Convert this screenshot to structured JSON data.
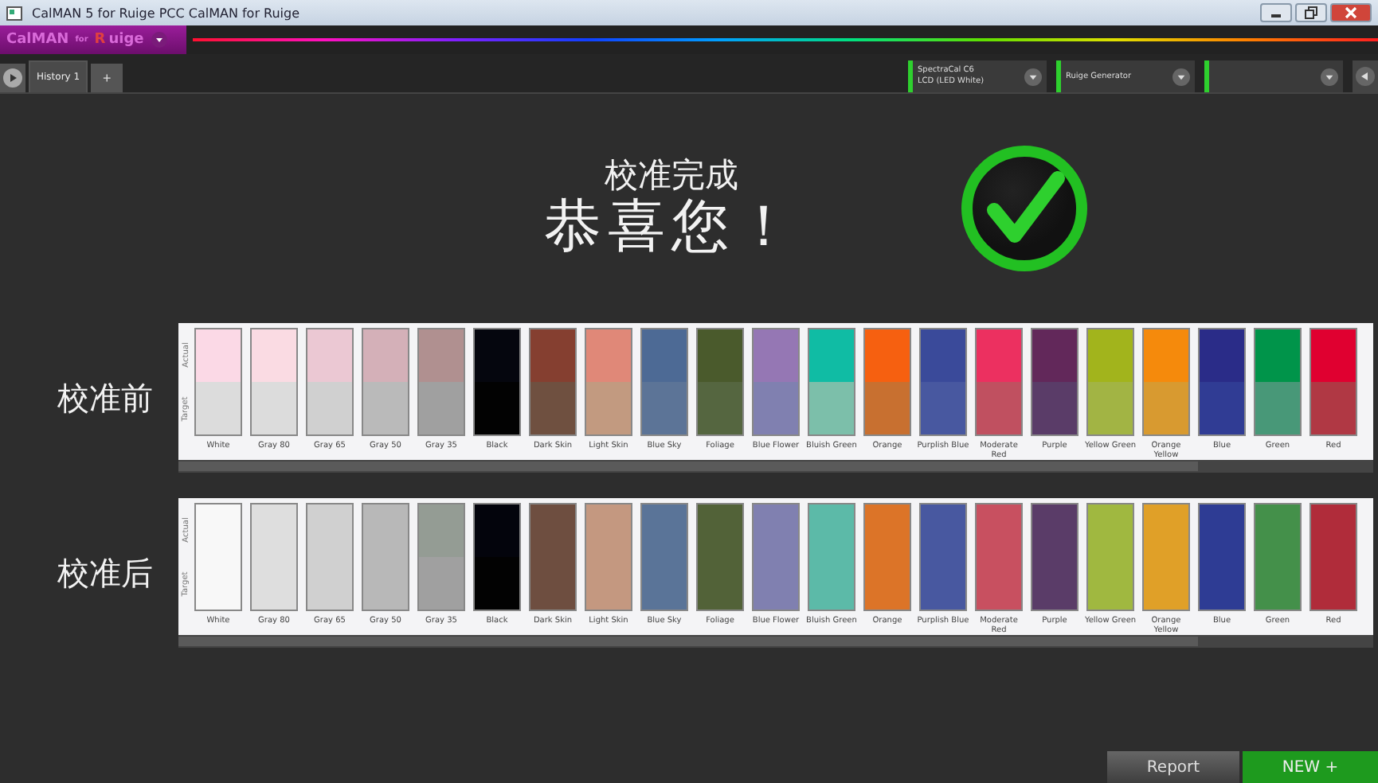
{
  "window": {
    "title": "CalMAN 5 for Ruige PCC CalMAN for Ruige"
  },
  "logo": {
    "name": "CalMAN",
    "connector": "for",
    "brand_initial": "R",
    "brand_rest": "uige"
  },
  "tabs": [
    {
      "label": "History 1",
      "selected": true
    }
  ],
  "add_tab": "+",
  "dropdowns": [
    {
      "kind": "labeled",
      "lines": [
        "SpectraCal C6",
        "LCD (LED White)"
      ]
    },
    {
      "kind": "labeled",
      "lines": [
        "Ruige Generator"
      ]
    },
    {
      "kind": "blank"
    }
  ],
  "heading": {
    "subtitle": "校准完成",
    "title": "恭喜您！"
  },
  "comparisons": [
    {
      "label": "校准前",
      "axis_actual": "Actual",
      "axis_target": "Target",
      "patches": [
        {
          "name": "White",
          "actual": {
            "color": "#fbd9e6"
          },
          "target": {
            "color": "#dcdcdc"
          }
        },
        {
          "name": "Gray 80",
          "actual": {
            "color": "#fadbe3"
          },
          "target": {
            "color": "#dcdcdc"
          }
        },
        {
          "name": "Gray 65",
          "actual": {
            "color": "#ebc8d3"
          },
          "target": {
            "color": "#d0d0d0"
          }
        },
        {
          "name": "Gray 50",
          "actual": {
            "color": "#d4b0b8"
          },
          "target": {
            "color": "#bababa"
          }
        },
        {
          "name": "Gray 35",
          "actual": {
            "color": "#b09090"
          },
          "target": {
            "color": "#a0a0a0"
          }
        },
        {
          "name": "Black",
          "actual": {
            "color": "#05060e"
          },
          "target": {
            "color": "#020202"
          }
        },
        {
          "name": "Dark Skin",
          "actual": {
            "color": "#853f30"
          },
          "target": {
            "color": "#6f5040"
          }
        },
        {
          "name": "Light Skin",
          "actual": {
            "color": "#e08878"
          },
          "target": {
            "color": "#c29a80"
          }
        },
        {
          "name": "Blue Sky",
          "actual": {
            "color": "#4d6a95"
          },
          "target": {
            "color": "#5c7497"
          }
        },
        {
          "name": "Foliage",
          "actual": {
            "color": "#4a5a2c"
          },
          "target": {
            "color": "#556640"
          }
        },
        {
          "name": "Blue Flower",
          "actual": {
            "color": "#9577b4"
          },
          "target": {
            "color": "#8080b0"
          }
        },
        {
          "name": "Bluish Green",
          "actual": {
            "color": "#10bca4"
          },
          "target": {
            "color": "#7cbfaa"
          }
        },
        {
          "name": "Orange",
          "actual": {
            "color": "#f66010"
          },
          "target": {
            "color": "#c87030"
          }
        },
        {
          "name": "Purplish Blue",
          "actual": {
            "color": "#3a4a9a"
          },
          "target": {
            "color": "#4858a0"
          }
        },
        {
          "name": "Moderate Red",
          "actual": {
            "color": "#ec3060"
          },
          "target": {
            "color": "#c05060"
          }
        },
        {
          "name": "Purple",
          "actual": {
            "color": "#62285a"
          },
          "target": {
            "color": "#5a3c68"
          }
        },
        {
          "name": "Yellow Green",
          "actual": {
            "color": "#a2b41c"
          },
          "target": {
            "color": "#a2b444"
          }
        },
        {
          "name": "Orange Yellow",
          "actual": {
            "color": "#f58a0c"
          },
          "target": {
            "color": "#d89a30"
          }
        },
        {
          "name": "Blue",
          "actual": {
            "color": "#2a2c88"
          },
          "target": {
            "color": "#303c94"
          }
        },
        {
          "name": "Green",
          "actual": {
            "color": "#00944a"
          },
          "target": {
            "color": "#489878"
          }
        },
        {
          "name": "Red",
          "actual": {
            "color": "#e00030"
          },
          "target": {
            "color": "#b03844"
          }
        }
      ]
    },
    {
      "label": "校准后",
      "axis_actual": "Actual",
      "axis_target": "Target",
      "patches": [
        {
          "name": "White",
          "actual": {
            "color": "#f8f8f8"
          },
          "target": {
            "color": "#f8f8f8"
          }
        },
        {
          "name": "Gray 80",
          "actual": {
            "color": "#dedede"
          },
          "target": {
            "color": "#dedede"
          }
        },
        {
          "name": "Gray 65",
          "actual": {
            "color": "#d0d0d0"
          },
          "target": {
            "color": "#d0d0d0"
          }
        },
        {
          "name": "Gray 50",
          "actual": {
            "color": "#b8b8b8"
          },
          "target": {
            "color": "#b8b8b8"
          }
        },
        {
          "name": "Gray 35",
          "actual": {
            "color": "#949c94"
          },
          "target": {
            "color": "#a0a0a0"
          }
        },
        {
          "name": "Black",
          "actual": {
            "color": "#03040c"
          },
          "target": {
            "color": "#020202"
          }
        },
        {
          "name": "Dark Skin",
          "actual": {
            "color": "#6e4e40"
          },
          "target": {
            "color": "#6e4e40"
          }
        },
        {
          "name": "Light Skin",
          "actual": {
            "color": "#c49880"
          },
          "target": {
            "color": "#c49880"
          }
        },
        {
          "name": "Blue Sky",
          "actual": {
            "color": "#5a7498"
          },
          "target": {
            "color": "#5a7498"
          }
        },
        {
          "name": "Foliage",
          "actual": {
            "color": "#526238"
          },
          "target": {
            "color": "#526238"
          }
        },
        {
          "name": "Blue Flower",
          "actual": {
            "color": "#8080b0"
          },
          "target": {
            "color": "#8080b0"
          }
        },
        {
          "name": "Bluish Green",
          "actual": {
            "color": "#5cbaa8"
          },
          "target": {
            "color": "#5cbaa8"
          }
        },
        {
          "name": "Orange",
          "actual": {
            "color": "#dc7428"
          },
          "target": {
            "color": "#dc7428"
          }
        },
        {
          "name": "Purplish Blue",
          "actual": {
            "color": "#4858a0"
          },
          "target": {
            "color": "#4858a0"
          }
        },
        {
          "name": "Moderate Red",
          "actual": {
            "color": "#c85060"
          },
          "target": {
            "color": "#c85060"
          }
        },
        {
          "name": "Purple",
          "actual": {
            "color": "#5a3c68"
          },
          "target": {
            "color": "#5a3c68"
          }
        },
        {
          "name": "Yellow Green",
          "actual": {
            "color": "#a0b840"
          },
          "target": {
            "color": "#a0b840"
          }
        },
        {
          "name": "Orange Yellow",
          "actual": {
            "color": "#e0a028"
          },
          "target": {
            "color": "#e0a028"
          }
        },
        {
          "name": "Blue",
          "actual": {
            "color": "#2e3c94"
          },
          "target": {
            "color": "#2e3c94"
          }
        },
        {
          "name": "Green",
          "actual": {
            "color": "#44904a"
          },
          "target": {
            "color": "#44904a"
          }
        },
        {
          "name": "Red",
          "actual": {
            "color": "#b02c3a"
          },
          "target": {
            "color": "#b02c3a"
          }
        }
      ]
    }
  ],
  "footer_buttons": [
    {
      "label": "Report",
      "kind": "secondary"
    },
    {
      "label": "NEW +",
      "kind": "primary"
    }
  ]
}
